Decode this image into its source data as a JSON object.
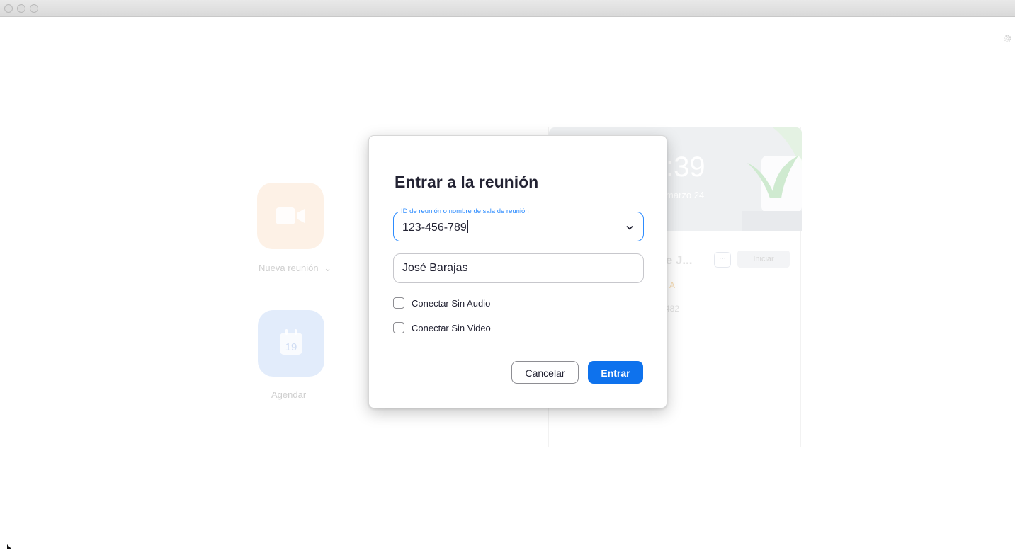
{
  "window": {
    "traffic_lights": [
      "close",
      "minimize",
      "zoom"
    ]
  },
  "toolbar": {
    "settings_icon": "gear-icon"
  },
  "home": {
    "new_meeting_label": "Nueva reunión",
    "new_meeting_chevron": "⌄",
    "schedule_label": "Agendar",
    "calendar_day": "19"
  },
  "upcoming": {
    "time": ":39",
    "date": "marzo 24",
    "meeting_title": "le J...",
    "more_label": "···",
    "start_label": "Iniciar",
    "subtitle": "A",
    "meeting_id_fragment": "-482"
  },
  "dialog": {
    "title": "Entrar a la reunión",
    "id_field": {
      "label": "ID de reunión o nombre de sala de reunión",
      "value": "123-456-789"
    },
    "name_field": {
      "value": "José Barajas"
    },
    "checkboxes": [
      {
        "label": "Conectar Sin Audio",
        "checked": false
      },
      {
        "label": "Conectar Sin Video",
        "checked": false
      }
    ],
    "cancel_label": "Cancelar",
    "join_label": "Entrar"
  },
  "colors": {
    "accent": "#2d8cff",
    "primary_button": "#0e72ed",
    "text": "#232333"
  }
}
